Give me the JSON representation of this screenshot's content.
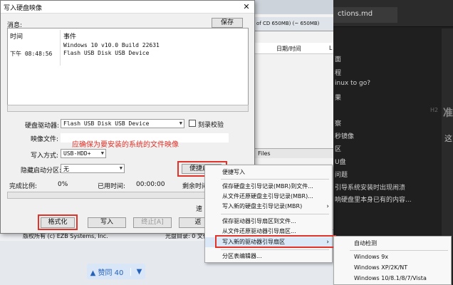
{
  "background": {
    "editor_tab": "ctions.md",
    "disk_info": "of CD 650MB) (~ 650MB)",
    "list_col_date": "日期/时间",
    "list_col_l": "L",
    "files_label": "Files",
    "statusbar_left": "版权所有 (c) EZB Systems, Inc.",
    "statusbar_right": "光盘目录: 0 文件",
    "upvote_label": "▲ 赞同 40",
    "downvote_icon": "▼",
    "heading_fragment": "准",
    "side_fragment": "这",
    "h2_marker": "H2",
    "right_text_lines": [
      "面",
      "程",
      "inux to go?",
      "果",
      "察",
      "秒镜像",
      "区",
      "U盘",
      "问题",
      "引导系统安装时出现闹溃",
      "响硬盘里本身已有的内容..."
    ]
  },
  "dialog": {
    "title": "写入硬盘映像",
    "close": "✕",
    "message_label": "消息:",
    "save_button": "保存",
    "log_headers": [
      "时间",
      "事件"
    ],
    "log_rows": [
      {
        "time": "",
        "event": "Windows 10 v10.0 Build 22631"
      },
      {
        "time": "下午 08:48:56",
        "event": "Flash USB Disk USB Device"
      }
    ],
    "drive_label": "硬盘驱动器:",
    "drive_value": "Flash USB Disk USB Device",
    "verify_label": "刻录校验",
    "image_label": "映像文件:",
    "image_annotation": "应确保为要安装的系统的文件映像",
    "write_mode_label": "写入方式:",
    "write_mode_value": "USB-HDD+",
    "hidden_partition_label": "隐藏启动分区:",
    "hidden_partition_value": "无",
    "xpress_button": "便捷启",
    "done_label": "完成比例:",
    "done_value": "0%",
    "elapsed_label": "已用时间:",
    "elapsed_value": "00:00:00",
    "remaining_label": "剩余时间",
    "speed_label": "速",
    "progress_fraction": 0,
    "buttons": {
      "format": "格式化",
      "write": "写入",
      "abort": "终止[A]",
      "back": "返"
    }
  },
  "context_menu": {
    "items": [
      {
        "label": "便捷写入"
      },
      {
        "label": "保存硬盘主引导记录(MBR)到文件..."
      },
      {
        "label": "从文件还原硬盘主引导记录(MBR)..."
      },
      {
        "label": "写入新的硬盘主引导记录(MBR)",
        "submenu": "›"
      },
      {
        "label": "保存驱动器引导扇区到文件..."
      },
      {
        "label": "从文件还原驱动器引导扇区..."
      },
      {
        "label": "写入新的驱动器引导扇区",
        "submenu": "›"
      },
      {
        "label": "分区表编辑器..."
      }
    ]
  },
  "submenu": {
    "items": [
      "自动检测",
      "Windows 9x",
      "Windows XP/2K/NT",
      "Windows 10/8.1/8/7/Vista"
    ]
  },
  "colors": {
    "annotation_red": "#e0332a",
    "progress_green": "#06b025"
  }
}
